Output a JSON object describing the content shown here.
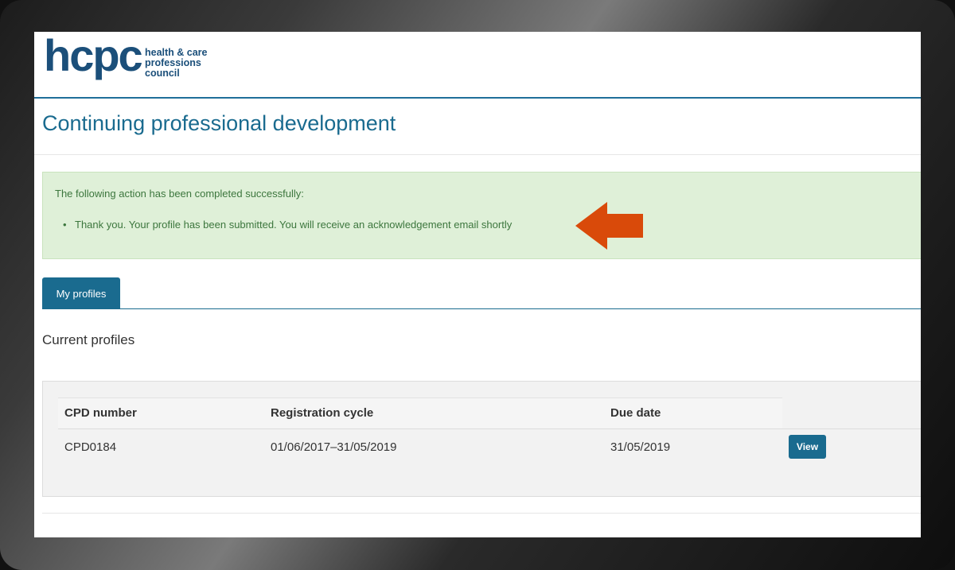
{
  "logo": {
    "mark": "hcpc",
    "words": [
      "health & care",
      "professions",
      "council"
    ]
  },
  "page": {
    "title": "Continuing professional development"
  },
  "alert": {
    "heading": "The following action has been completed successfully:",
    "items": [
      "Thank you. Your profile has been submitted. You will receive an acknowledgement email shortly"
    ],
    "arrow_color": "#d94a0a"
  },
  "tabs": [
    {
      "label": "My profiles",
      "active": true
    }
  ],
  "section": {
    "title": "Current profiles"
  },
  "table": {
    "columns": [
      "CPD number",
      "Registration cycle",
      "Due date"
    ],
    "rows": [
      {
        "cpd_number": "CPD0184",
        "registration_cycle": "01/06/2017–31/05/2019",
        "due_date": "31/05/2019",
        "action": "View"
      }
    ]
  },
  "colors": {
    "brand": "#1a6b8f",
    "logo": "#1b4f7a",
    "success_bg": "#dff0d8",
    "success_text": "#3c763d"
  }
}
